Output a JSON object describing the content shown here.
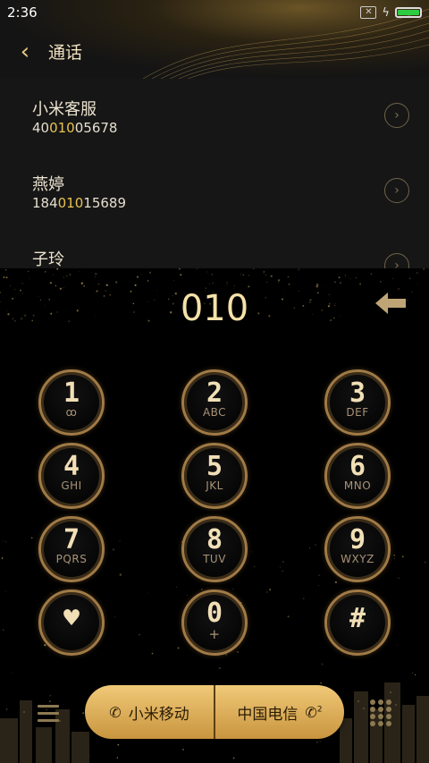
{
  "status": {
    "time": "2:36",
    "battery_level": 1.0
  },
  "header": {
    "title": "通话",
    "back_icon": "back-chevron-icon"
  },
  "contacts": [
    {
      "name": "小米客服",
      "number_prefix": "40",
      "number_match": "010",
      "number_suffix": "05678"
    },
    {
      "name": "燕婷",
      "number_prefix": "184",
      "number_match": "010",
      "number_suffix": "15689"
    },
    {
      "name": "子玲"
    }
  ],
  "dialer": {
    "entered": "010",
    "keys": [
      {
        "digit": "1",
        "letters": "ꝏ"
      },
      {
        "digit": "2",
        "letters": "ABC"
      },
      {
        "digit": "3",
        "letters": "DEF"
      },
      {
        "digit": "4",
        "letters": "GHI"
      },
      {
        "digit": "5",
        "letters": "JKL"
      },
      {
        "digit": "6",
        "letters": "MNO"
      },
      {
        "digit": "7",
        "letters": "PQRS"
      },
      {
        "digit": "8",
        "letters": "TUV"
      },
      {
        "digit": "9",
        "letters": "WXYZ"
      },
      {
        "digit": "♥",
        "letters": ""
      },
      {
        "digit": "0",
        "letters": "+"
      },
      {
        "digit": "#",
        "letters": ""
      }
    ]
  },
  "call_buttons": {
    "sim1": "小米移动",
    "sim2": "中国电信"
  },
  "colors": {
    "accent_gold": "#e8c24f",
    "button_gold": "#e0b25c"
  }
}
